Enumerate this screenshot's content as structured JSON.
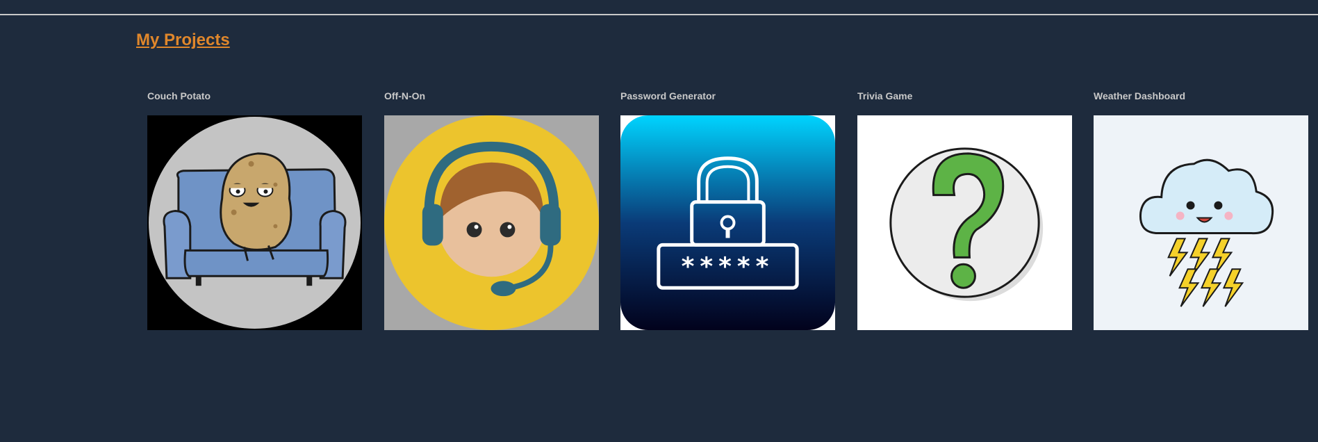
{
  "header": {
    "title": "My Projects"
  },
  "projects": [
    {
      "title": "Couch Potato",
      "icon": "couch-potato-icon"
    },
    {
      "title": "Off-N-On",
      "icon": "headset-avatar-icon"
    },
    {
      "title": "Password Generator",
      "icon": "padlock-password-icon"
    },
    {
      "title": "Trivia Game",
      "icon": "question-mark-icon"
    },
    {
      "title": "Weather Dashboard",
      "icon": "storm-cloud-icon"
    }
  ]
}
